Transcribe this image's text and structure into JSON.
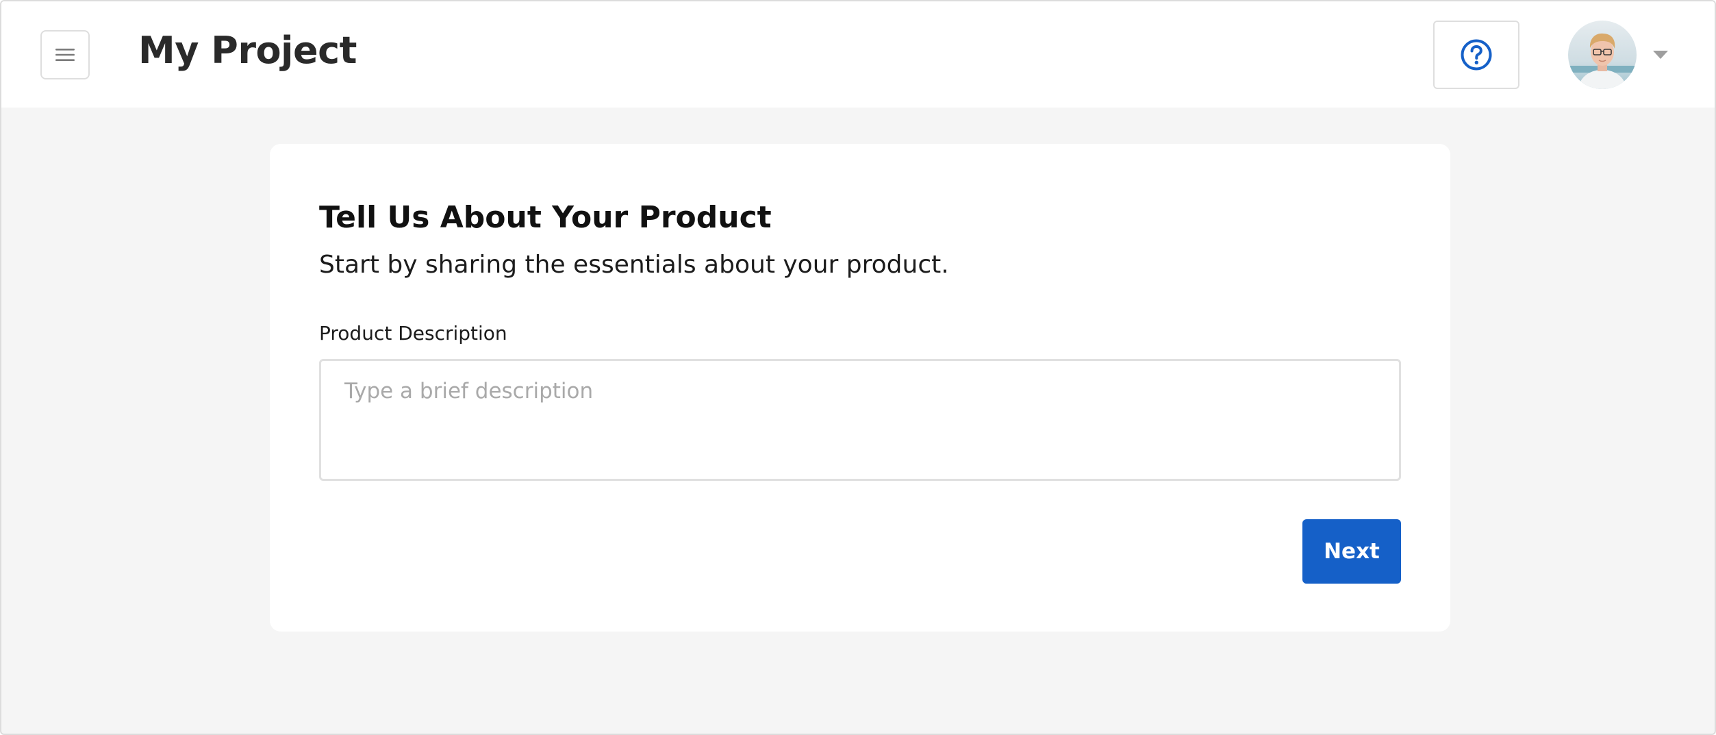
{
  "header": {
    "menu_icon": "hamburger-icon",
    "title": "My Project",
    "help_icon": "question-circle-icon",
    "avatar_icon": "user-avatar",
    "caret_icon": "caret-down-icon"
  },
  "form": {
    "title": "Tell Us About Your Product",
    "subtitle": "Start by sharing the essentials about your product.",
    "field_label": "Product Description",
    "field_placeholder": "Type a brief description",
    "field_value": "",
    "next_label": "Next"
  },
  "colors": {
    "accent": "#1560c8",
    "background": "#f5f5f5",
    "card": "#ffffff",
    "border": "#dedede"
  }
}
